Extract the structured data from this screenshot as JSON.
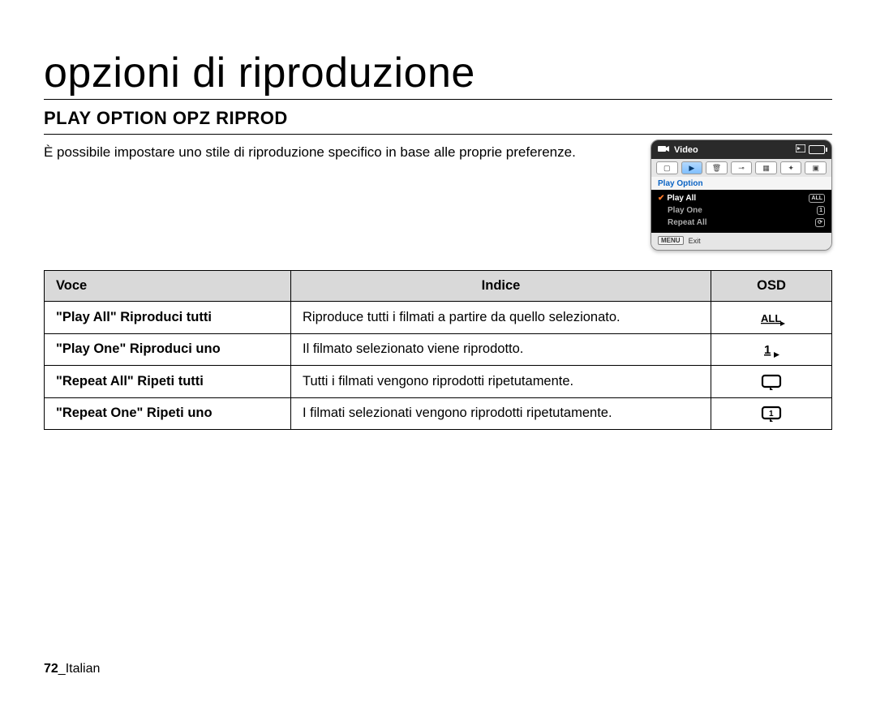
{
  "title": "opzioni di riproduzione",
  "section_heading": "PLAY OPTION OPZ RIPROD",
  "intro": "È possibile impostare uno stile di riproduzione specifico in base alle proprie preferenze.",
  "osd_preview": {
    "header": "Video",
    "menu_label": "Play Option",
    "options": [
      {
        "label": "Play All",
        "icon": "ALL",
        "selected": true
      },
      {
        "label": "Play One",
        "icon": "1",
        "selected": false
      },
      {
        "label": "Repeat All",
        "icon": "⟳",
        "selected": false
      }
    ],
    "footer_key": "MENU",
    "footer_text": "Exit"
  },
  "table": {
    "headers": {
      "voce": "Voce",
      "indice": "Indice",
      "osd": "OSD"
    },
    "rows": [
      {
        "voce": "\"Play All\" Riproduci tutti",
        "indice": "Riproduce tutti i filmati a partire da quello selezionato.",
        "osd_icon": "all"
      },
      {
        "voce": "\"Play One\" Riproduci uno",
        "indice": "Il filmato selezionato viene riprodotto.",
        "osd_icon": "one"
      },
      {
        "voce": "\"Repeat All\" Ripeti tutti",
        "indice": "Tutti i filmati vengono riprodotti ripetutamente.",
        "osd_icon": "repeat_all"
      },
      {
        "voce": "\"Repeat One\" Ripeti uno",
        "indice": "I filmati selezionati vengono riprodotti ripetutamente.",
        "osd_icon": "repeat_one"
      }
    ]
  },
  "footer": {
    "page_number": "72",
    "lang": "Italian"
  }
}
